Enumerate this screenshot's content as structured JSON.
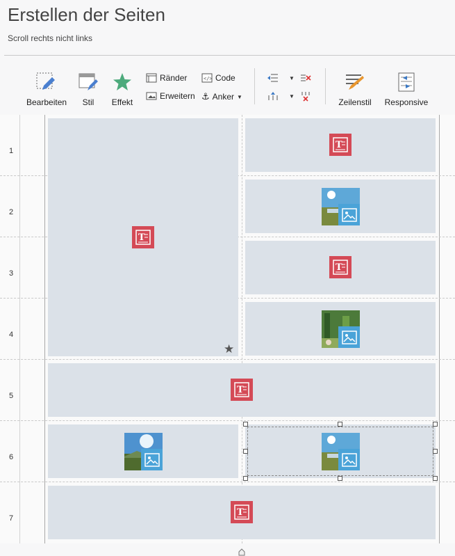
{
  "page": {
    "title": "Erstellen der Seiten",
    "subtitle": "Scroll rechts nicht links"
  },
  "toolbar": {
    "bearbeiten": "Bearbeiten",
    "stil": "Stil",
    "effekt": "Effekt",
    "raender": "Ränder",
    "erweitern": "Erweitern",
    "code": "Code",
    "anker": "Anker",
    "zeilenstil": "Zeilenstil",
    "responsive": "Responsive"
  },
  "rows": [
    "1",
    "2",
    "3",
    "4",
    "5",
    "6",
    "7"
  ],
  "colors": {
    "text_block": "#d44a56",
    "image_block": "#4aa3d8",
    "cell_bg": "#dbe1e8"
  }
}
